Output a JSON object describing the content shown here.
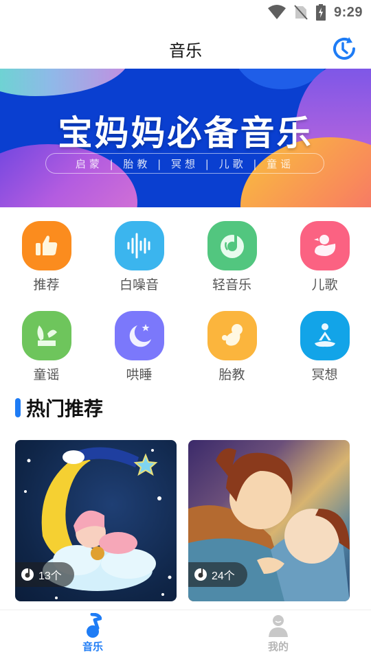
{
  "status_bar": {
    "time": "9:29",
    "icons": [
      "wifi-icon",
      "no-sim-icon",
      "battery-charging-icon"
    ]
  },
  "header": {
    "title": "音乐",
    "history_icon": "history-clock-icon"
  },
  "banner": {
    "title": "宝妈妈必备音乐",
    "subtitle": "启蒙 | 胎教 | 冥想 | 儿歌 | 童谣"
  },
  "categories": [
    {
      "label": "推荐",
      "icon": "thumbs-up-icon",
      "color": "#fb8c1e"
    },
    {
      "label": "白噪音",
      "icon": "sound-wave-icon",
      "color": "#3bb5ee"
    },
    {
      "label": "轻音乐",
      "icon": "music-disc-icon",
      "color": "#52c67f"
    },
    {
      "label": "儿歌",
      "icon": "duck-icon",
      "color": "#fb6282"
    },
    {
      "label": "童谣",
      "icon": "bunny-ears-icon",
      "color": "#6ec55c"
    },
    {
      "label": "哄睡",
      "icon": "moon-star-icon",
      "color": "#7b78fb"
    },
    {
      "label": "胎教",
      "icon": "fetus-icon",
      "color": "#fbb53d"
    },
    {
      "label": "冥想",
      "icon": "meditation-icon",
      "color": "#12a4e8"
    }
  ],
  "hot_section": {
    "title": "热门推荐",
    "accent_color": "#1e7cf5",
    "cards": [
      {
        "count": "13个",
        "image": "sleeping-baby-on-moon-illustration"
      },
      {
        "count": "24个",
        "image": "mother-tucking-in-child-illustration"
      }
    ]
  },
  "bottom_nav": {
    "items": [
      {
        "label": "音乐",
        "icon": "music-note-icon",
        "active": true,
        "color": "#1e7cf5"
      },
      {
        "label": "我的",
        "icon": "user-icon",
        "active": false,
        "color": "#b5b5b5"
      }
    ]
  }
}
